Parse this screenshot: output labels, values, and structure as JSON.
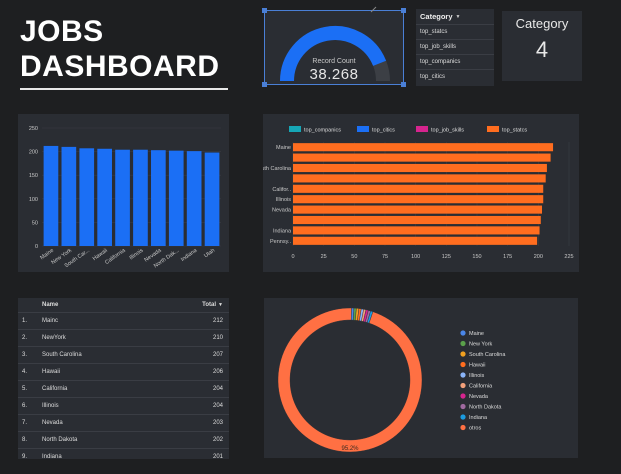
{
  "title": {
    "line1": "JOBS",
    "line2": "DASHBOARD"
  },
  "gauge": {
    "label": "Record Count",
    "value": "38.268",
    "fill_fraction": 0.88,
    "accent": "#1b6ff5",
    "track": "#3c3f45"
  },
  "category_filter": {
    "header": "Category",
    "options": [
      "top_statcs",
      "top_job_skills",
      "top_companics",
      "top_citics"
    ]
  },
  "category_card": {
    "label": "Category",
    "value": "4"
  },
  "colors": {
    "bar_blue": "#1b6ff5",
    "bar_orange": "#ff6d1f",
    "teal": "#16a6b6",
    "magenta": "#d6248e",
    "grid": "#3a3d44",
    "axis_text": "#c8c8c8"
  },
  "chart_data": [
    {
      "type": "bar",
      "categories": [
        "Maine",
        "New York",
        "South Car...",
        "Hawaii",
        "California",
        "Illinois",
        "Nevada",
        "North Dak...",
        "Indiana",
        "Utah"
      ],
      "values": [
        212,
        210,
        207,
        206,
        204,
        204,
        203,
        202,
        201,
        198
      ],
      "ylim": [
        0,
        250
      ],
      "yticks": [
        "0",
        "50",
        "100",
        "150",
        "200",
        "250"
      ]
    },
    {
      "type": "bar",
      "orientation": "horizontal",
      "legend": [
        "top_companics",
        "top_citics",
        "top_job_skills",
        "top_statcs"
      ],
      "legend_colors": [
        "#16a6b6",
        "#1b6ff5",
        "#d6248e",
        "#ff6d1f"
      ],
      "categories": [
        "Maine",
        "",
        "South Carolina",
        "",
        "Califor..",
        "Illinois",
        "Nevada",
        "",
        "Indiana",
        "Pennsy.."
      ],
      "values": [
        212,
        210,
        207,
        206,
        204,
        204,
        203,
        202,
        201,
        199
      ],
      "xlim": [
        0,
        225
      ],
      "xticks": [
        "0",
        "25",
        "50",
        "75",
        "100",
        "125",
        "150",
        "175",
        "200",
        "225"
      ]
    },
    {
      "type": "pie",
      "legend": [
        "Maine",
        "New York",
        "South Carolina",
        "Hawaii",
        "Illinois",
        "California",
        "Nevada",
        "North Dakota",
        "Indiana",
        "otros"
      ],
      "legend_colors": [
        "#4a86e8",
        "#5aa04a",
        "#f0a020",
        "#ff6d1f",
        "#8ab4f8",
        "#f2a07b",
        "#d6248e",
        "#a06aa0",
        "#1b9be0",
        "#ff7043"
      ],
      "values": [
        0.55,
        0.55,
        0.55,
        0.54,
        0.53,
        0.53,
        0.53,
        0.53,
        0.53,
        95.2
      ],
      "center_label": "95.2%"
    }
  ],
  "table": {
    "headers": {
      "name": "Name",
      "total": "Total"
    },
    "rows": [
      {
        "idx": "1.",
        "name": "Mainc",
        "total": "212"
      },
      {
        "idx": "2.",
        "name": "NewYork",
        "total": "210"
      },
      {
        "idx": "3.",
        "name": "South Carolina",
        "total": "207"
      },
      {
        "idx": "4.",
        "name": "Hawaii",
        "total": "206"
      },
      {
        "idx": "5.",
        "name": "California",
        "total": "204"
      },
      {
        "idx": "6.",
        "name": "Illinois",
        "total": "204"
      },
      {
        "idx": "7.",
        "name": "Nevada",
        "total": "203"
      },
      {
        "idx": "8.",
        "name": "North Dakota",
        "total": "202"
      },
      {
        "idx": "9.",
        "name": "Indiana",
        "total": "201"
      },
      {
        "idx": "10.",
        "name": "Connecticut",
        "total": "199"
      }
    ]
  }
}
